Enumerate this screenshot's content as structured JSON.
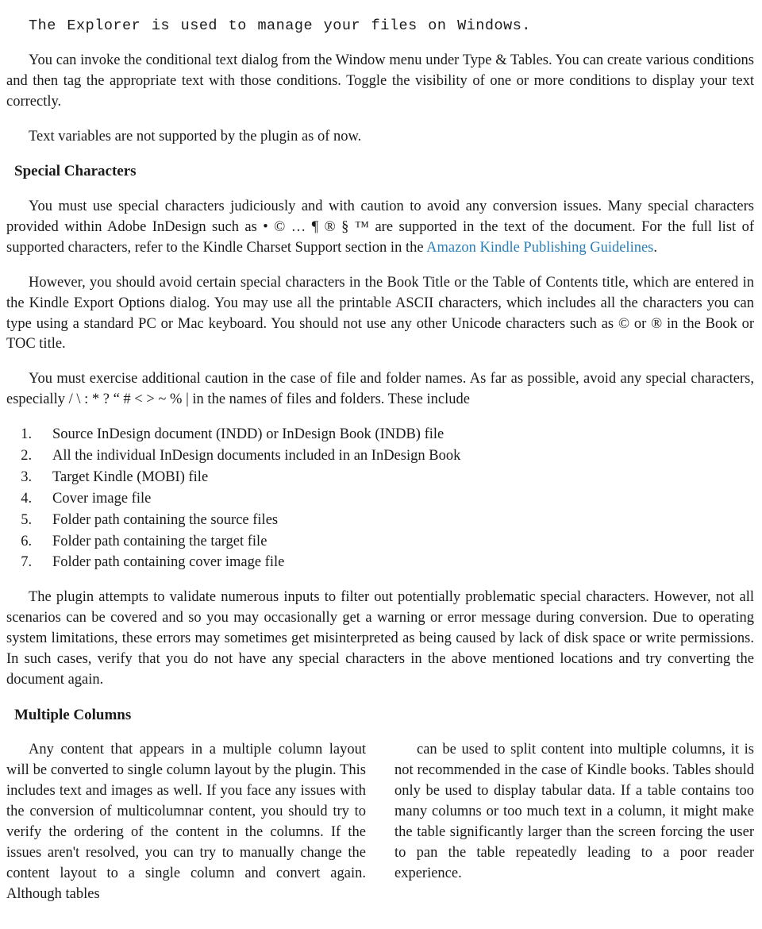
{
  "mono_line": "The Explorer is used to manage your files on Windows.",
  "p1": "You can invoke the conditional text dialog from the Window menu under Type & Tables. You can create various conditions and then tag the appropriate text with those conditions. Toggle the visibility of one or more conditions to display your text correctly.",
  "p2": "Text variables are not supported by the plugin as of now.",
  "h1": "Special Characters",
  "p3a": "You must use special characters judiciously and with caution to avoid any conversion issues. Many special characters provided within Adobe InDesign such as • © … ¶ ® § ™ are supported in the text of the document. For the full list of supported characters, refer to the Kindle Charset Support section in the ",
  "p3link": "Amazon Kindle Publishing Guidelines",
  "p3b": ".",
  "p4": "However, you should avoid certain special characters in the Book Title or the Table of Contents title, which are entered in the Kindle Export Options dialog. You may use all the printable ASCII characters, which includes all the characters you can type using a standard PC or Mac keyboard. You should not use any other Unicode characters such as © or ® in the Book or TOC title.",
  "p5": "You must exercise additional caution in the case of file and folder names. As far as possible, avoid any special characters, especially / \\ : * ? “ # < > ~ % | in the names of files and folders. These include",
  "list": [
    "Source InDesign document (INDD) or InDesign Book (INDB) file",
    "All the individual InDesign documents included in an InDesign Book",
    "Target Kindle (MOBI) file",
    "Cover image file",
    "Folder path containing the source files",
    "Folder path containing the target file",
    "Folder path containing cover image file"
  ],
  "p6": "The plugin attempts to validate numerous inputs to filter out potentially problematic special characters. However, not all scenarios can be covered and so you may occasionally get a warning or error message during conversion. Due to operating system limitations, these errors may sometimes get misinterpreted as being caused by lack of disk space or write permissions. In such cases, verify that you do not have any special characters in the above mentioned locations and try converting the document again.",
  "h2": "Multiple Columns",
  "col1": "Any content that appears in a multiple column layout will be converted to single column layout by the plugin. This includes text and images as well. If you face any issues with the conversion of multicolumnar content, you should try to verify the ordering of the content in the columns. If the issues aren't resolved, you can try to manually change the content layout to a single column and convert again. Although tables",
  "col2": "can be used to split content into multiple columns, it is not recommended in the case of Kindle books. Tables should only be used to display tabular data. If a table contains too many columns or too much text in a column, it might make the table significantly larger than the screen forcing the user to pan the table repeatedly leading to a poor reader experience."
}
